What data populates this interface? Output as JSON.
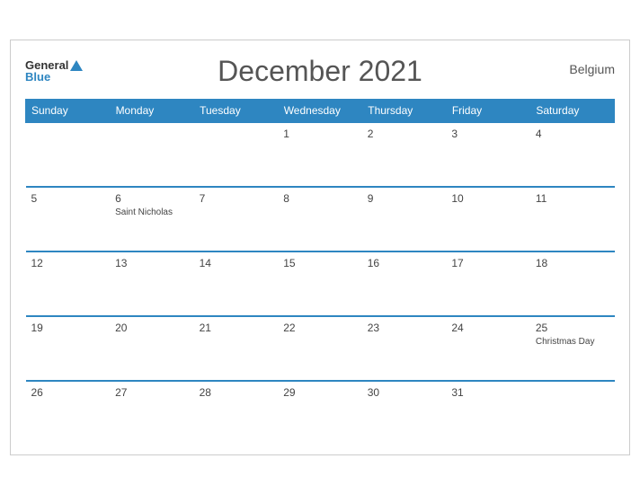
{
  "header": {
    "logo_general": "General",
    "logo_blue": "Blue",
    "title": "December 2021",
    "country": "Belgium"
  },
  "weekdays": [
    "Sunday",
    "Monday",
    "Tuesday",
    "Wednesday",
    "Thursday",
    "Friday",
    "Saturday"
  ],
  "weeks": [
    [
      {
        "day": "",
        "holiday": ""
      },
      {
        "day": "",
        "holiday": ""
      },
      {
        "day": "",
        "holiday": ""
      },
      {
        "day": "1",
        "holiday": ""
      },
      {
        "day": "2",
        "holiday": ""
      },
      {
        "day": "3",
        "holiday": ""
      },
      {
        "day": "4",
        "holiday": ""
      }
    ],
    [
      {
        "day": "5",
        "holiday": ""
      },
      {
        "day": "6",
        "holiday": "Saint Nicholas"
      },
      {
        "day": "7",
        "holiday": ""
      },
      {
        "day": "8",
        "holiday": ""
      },
      {
        "day": "9",
        "holiday": ""
      },
      {
        "day": "10",
        "holiday": ""
      },
      {
        "day": "11",
        "holiday": ""
      }
    ],
    [
      {
        "day": "12",
        "holiday": ""
      },
      {
        "day": "13",
        "holiday": ""
      },
      {
        "day": "14",
        "holiday": ""
      },
      {
        "day": "15",
        "holiday": ""
      },
      {
        "day": "16",
        "holiday": ""
      },
      {
        "day": "17",
        "holiday": ""
      },
      {
        "day": "18",
        "holiday": ""
      }
    ],
    [
      {
        "day": "19",
        "holiday": ""
      },
      {
        "day": "20",
        "holiday": ""
      },
      {
        "day": "21",
        "holiday": ""
      },
      {
        "day": "22",
        "holiday": ""
      },
      {
        "day": "23",
        "holiday": ""
      },
      {
        "day": "24",
        "holiday": ""
      },
      {
        "day": "25",
        "holiday": "Christmas Day"
      }
    ],
    [
      {
        "day": "26",
        "holiday": ""
      },
      {
        "day": "27",
        "holiday": ""
      },
      {
        "day": "28",
        "holiday": ""
      },
      {
        "day": "29",
        "holiday": ""
      },
      {
        "day": "30",
        "holiday": ""
      },
      {
        "day": "31",
        "holiday": ""
      },
      {
        "day": "",
        "holiday": ""
      }
    ]
  ]
}
